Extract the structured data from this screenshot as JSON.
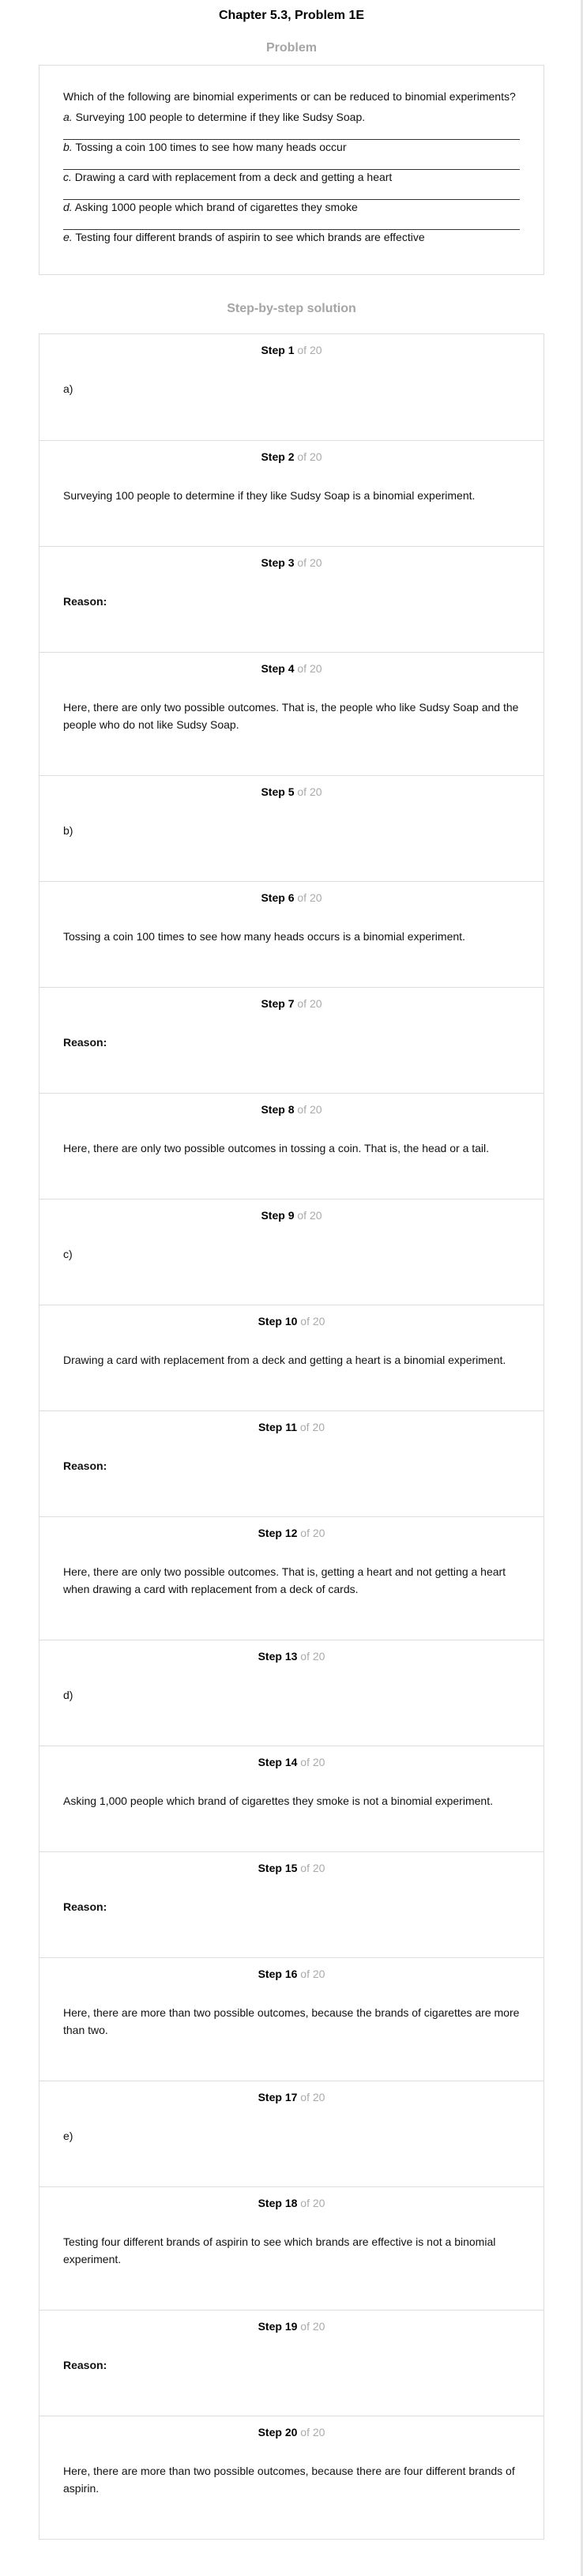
{
  "header": {
    "title": "Chapter 5.3, Problem 1E"
  },
  "problem": {
    "heading": "Problem",
    "question": "Which of the following are binomial experiments or can be reduced to binomial experiments?",
    "options": [
      {
        "letter": "a.",
        "text": " Surveying 100 people to determine if they like Sudsy Soap."
      },
      {
        "letter": "b.",
        "text": " Tossing a coin 100 times to see how many heads occur"
      },
      {
        "letter": "c.",
        "text": " Drawing a card with replacement from a deck and getting a heart"
      },
      {
        "letter": "d.",
        "text": " Asking 1000 people which brand of cigarettes they smoke"
      },
      {
        "letter": "e.",
        "text": " Testing four different brands of aspirin to see which brands are effective"
      }
    ]
  },
  "solution": {
    "heading": "Step-by-step solution",
    "step_word": "Step",
    "of_total": "of 20",
    "steps": [
      {
        "number": "1",
        "text": "a)"
      },
      {
        "number": "2",
        "text": "Surveying 100 people to determine if they like Sudsy Soap is a binomial experiment."
      },
      {
        "number": "3",
        "text": "Reason:"
      },
      {
        "number": "4",
        "text": "Here, there are only two possible outcomes. That is, the people who like Sudsy Soap and the people who do not like Sudsy Soap."
      },
      {
        "number": "5",
        "text": "b)"
      },
      {
        "number": "6",
        "text": "Tossing a coin 100 times to see how many heads occurs is a binomial experiment."
      },
      {
        "number": "7",
        "text": "Reason:"
      },
      {
        "number": "8",
        "text": "Here, there are only two possible outcomes in tossing a coin. That is, the head or a tail."
      },
      {
        "number": "9",
        "text": "c)"
      },
      {
        "number": "10",
        "text": "Drawing a card with replacement from a deck and getting a heart is a binomial experiment."
      },
      {
        "number": "11",
        "text": "Reason:"
      },
      {
        "number": "12",
        "text": "Here, there are only two possible outcomes. That is, getting a heart and not getting a heart when drawing a card with replacement from a deck of cards."
      },
      {
        "number": "13",
        "text": "d)"
      },
      {
        "number": "14",
        "text": "Asking 1,000 people which brand of cigarettes they smoke is not a binomial experiment."
      },
      {
        "number": "15",
        "text": "Reason:"
      },
      {
        "number": "16",
        "text": "Here, there are more than two possible outcomes, because the brands of cigarettes are more than two."
      },
      {
        "number": "17",
        "text": "e)"
      },
      {
        "number": "18",
        "text": "Testing four different brands of aspirin to see which brands are effective is not a binomial experiment."
      },
      {
        "number": "19",
        "text": "Reason:"
      },
      {
        "number": "20",
        "text": "Here, there are more than two possible outcomes, because there are four different brands of aspirin."
      }
    ]
  }
}
